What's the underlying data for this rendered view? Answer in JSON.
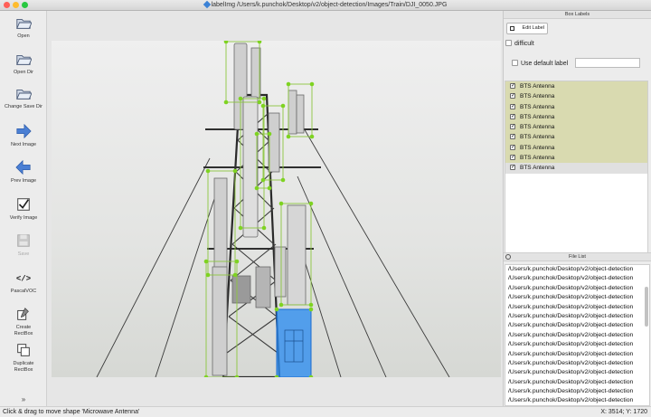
{
  "window": {
    "title": "labelImg /Users/k.punchok/Desktop/v2/object-detection/Images/Train/DJI_0050.JPG"
  },
  "toolbar": {
    "items": [
      {
        "label": "Open",
        "icon": "folder-open-icon"
      },
      {
        "label": "Open Dir",
        "icon": "folder-open-icon"
      },
      {
        "label": "Change Save Dir",
        "icon": "folder-open-icon"
      },
      {
        "label": "Next Image",
        "icon": "arrow-right-icon"
      },
      {
        "label": "Prev Image",
        "icon": "arrow-left-icon"
      },
      {
        "label": "Verify Image",
        "icon": "checkbox-icon"
      },
      {
        "label": "Save",
        "icon": "floppy-disk-icon",
        "disabled": true
      },
      {
        "label": "PascalVOC",
        "icon": "code-brackets-icon"
      },
      {
        "label": "Create\nRectBox",
        "icon": "create-rectbox-icon"
      },
      {
        "label": "Duplicate\nRectBox",
        "icon": "duplicate-rectbox-icon"
      }
    ],
    "more_icon": "double-chevron-down-icon"
  },
  "box_labels": {
    "header": "Box Labels",
    "edit_label_button": "Edit Label",
    "difficult_label": "difficult",
    "difficult_checked": false,
    "use_default_label": "Use default label",
    "use_default_checked": false,
    "default_label_value": "",
    "labels": [
      {
        "name": "BTS Antenna",
        "checked": true
      },
      {
        "name": "BTS Antenna",
        "checked": true
      },
      {
        "name": "BTS Antenna",
        "checked": true
      },
      {
        "name": "BTS Antenna",
        "checked": true
      },
      {
        "name": "BTS Antenna",
        "checked": true
      },
      {
        "name": "BTS Antenna",
        "checked": true
      },
      {
        "name": "BTS Antenna",
        "checked": true
      },
      {
        "name": "BTS Antenna",
        "checked": true
      },
      {
        "name": "BTS Antenna",
        "checked": true,
        "selected": true
      }
    ],
    "label_color": "#d9dab0"
  },
  "file_list": {
    "header": "File List",
    "files": [
      "/Users/k.punchok/Desktop/v2/object-detection",
      "/Users/k.punchok/Desktop/v2/object-detection",
      "/Users/k.punchok/Desktop/v2/object-detection",
      "/Users/k.punchok/Desktop/v2/object-detection",
      "/Users/k.punchok/Desktop/v2/object-detection",
      "/Users/k.punchok/Desktop/v2/object-detection",
      "/Users/k.punchok/Desktop/v2/object-detection",
      "/Users/k.punchok/Desktop/v2/object-detection",
      "/Users/k.punchok/Desktop/v2/object-detection",
      "/Users/k.punchok/Desktop/v2/object-detection",
      "/Users/k.punchok/Desktop/v2/object-detection",
      "/Users/k.punchok/Desktop/v2/object-detection",
      "/Users/k.punchok/Desktop/v2/object-detection",
      "/Users/k.punchok/Desktop/v2/object-detection",
      "/Users/k.punchok/Desktop/v2/object-detection"
    ]
  },
  "status": {
    "message": "Click & drag to move shape 'Microwave Antenna'",
    "coords": "X: 3514; Y: 1720"
  },
  "colors": {
    "box_outline": "#8cc63f",
    "box_vertex": "#7ed321",
    "selected_fill": "#2b8cf0"
  }
}
